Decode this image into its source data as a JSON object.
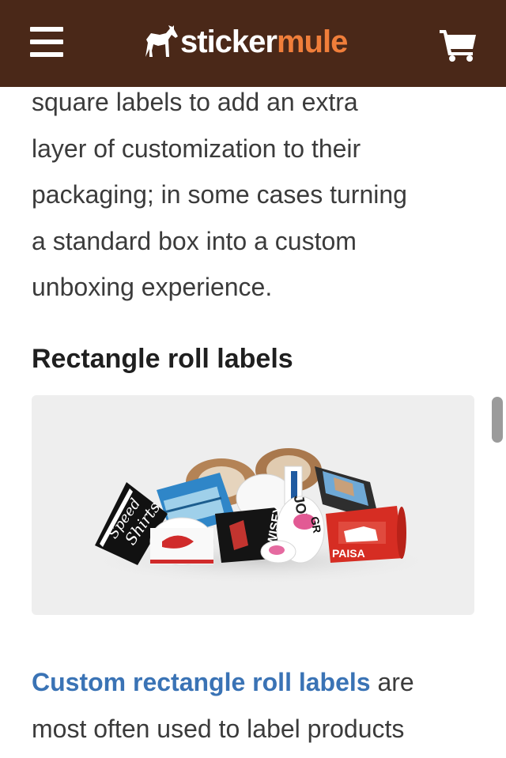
{
  "header": {
    "menu_icon": "hamburger-icon",
    "logo_word1": "sticker",
    "logo_word2": "mule",
    "cart_icon": "cart-icon"
  },
  "article": {
    "intro_lines": [
      "square labels to add an extra",
      "layer of customization to their",
      "packaging; in some cases turning",
      "a standard box into a custom",
      "unboxing experience."
    ],
    "heading": "Rectangle roll labels",
    "image": {
      "roll_texts": {
        "speed": "Speed",
        "shirts": "Shirts",
        "wisey": "WISEY",
        "paisa": "PAISA",
        "joy": "JOY",
        "gr": "GR"
      }
    },
    "link_text": "Custom rectangle roll labels",
    "after_link": " are",
    "line2": "most often used to label products"
  },
  "colors": {
    "header_bg": "#4a2818",
    "brand_orange": "#f07e3a",
    "link": "#3a73b5",
    "body_text": "#3b3b3b"
  }
}
